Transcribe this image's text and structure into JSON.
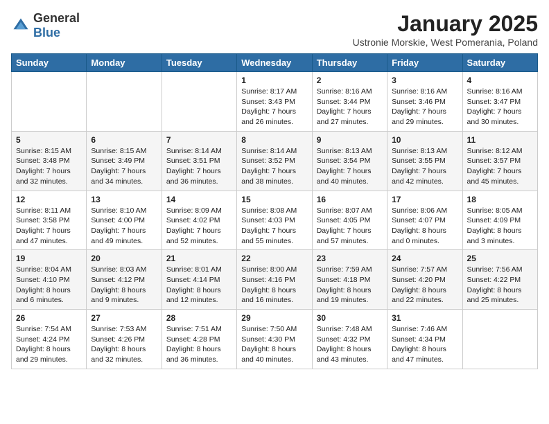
{
  "logo": {
    "general": "General",
    "blue": "Blue"
  },
  "title": "January 2025",
  "subtitle": "Ustronie Morskie, West Pomerania, Poland",
  "days_header": [
    "Sunday",
    "Monday",
    "Tuesday",
    "Wednesday",
    "Thursday",
    "Friday",
    "Saturday"
  ],
  "weeks": [
    [
      {
        "day": "",
        "content": ""
      },
      {
        "day": "",
        "content": ""
      },
      {
        "day": "",
        "content": ""
      },
      {
        "day": "1",
        "content": "Sunrise: 8:17 AM\nSunset: 3:43 PM\nDaylight: 7 hours and 26 minutes."
      },
      {
        "day": "2",
        "content": "Sunrise: 8:16 AM\nSunset: 3:44 PM\nDaylight: 7 hours and 27 minutes."
      },
      {
        "day": "3",
        "content": "Sunrise: 8:16 AM\nSunset: 3:46 PM\nDaylight: 7 hours and 29 minutes."
      },
      {
        "day": "4",
        "content": "Sunrise: 8:16 AM\nSunset: 3:47 PM\nDaylight: 7 hours and 30 minutes."
      }
    ],
    [
      {
        "day": "5",
        "content": "Sunrise: 8:15 AM\nSunset: 3:48 PM\nDaylight: 7 hours and 32 minutes."
      },
      {
        "day": "6",
        "content": "Sunrise: 8:15 AM\nSunset: 3:49 PM\nDaylight: 7 hours and 34 minutes."
      },
      {
        "day": "7",
        "content": "Sunrise: 8:14 AM\nSunset: 3:51 PM\nDaylight: 7 hours and 36 minutes."
      },
      {
        "day": "8",
        "content": "Sunrise: 8:14 AM\nSunset: 3:52 PM\nDaylight: 7 hours and 38 minutes."
      },
      {
        "day": "9",
        "content": "Sunrise: 8:13 AM\nSunset: 3:54 PM\nDaylight: 7 hours and 40 minutes."
      },
      {
        "day": "10",
        "content": "Sunrise: 8:13 AM\nSunset: 3:55 PM\nDaylight: 7 hours and 42 minutes."
      },
      {
        "day": "11",
        "content": "Sunrise: 8:12 AM\nSunset: 3:57 PM\nDaylight: 7 hours and 45 minutes."
      }
    ],
    [
      {
        "day": "12",
        "content": "Sunrise: 8:11 AM\nSunset: 3:58 PM\nDaylight: 7 hours and 47 minutes."
      },
      {
        "day": "13",
        "content": "Sunrise: 8:10 AM\nSunset: 4:00 PM\nDaylight: 7 hours and 49 minutes."
      },
      {
        "day": "14",
        "content": "Sunrise: 8:09 AM\nSunset: 4:02 PM\nDaylight: 7 hours and 52 minutes."
      },
      {
        "day": "15",
        "content": "Sunrise: 8:08 AM\nSunset: 4:03 PM\nDaylight: 7 hours and 55 minutes."
      },
      {
        "day": "16",
        "content": "Sunrise: 8:07 AM\nSunset: 4:05 PM\nDaylight: 7 hours and 57 minutes."
      },
      {
        "day": "17",
        "content": "Sunrise: 8:06 AM\nSunset: 4:07 PM\nDaylight: 8 hours and 0 minutes."
      },
      {
        "day": "18",
        "content": "Sunrise: 8:05 AM\nSunset: 4:09 PM\nDaylight: 8 hours and 3 minutes."
      }
    ],
    [
      {
        "day": "19",
        "content": "Sunrise: 8:04 AM\nSunset: 4:10 PM\nDaylight: 8 hours and 6 minutes."
      },
      {
        "day": "20",
        "content": "Sunrise: 8:03 AM\nSunset: 4:12 PM\nDaylight: 8 hours and 9 minutes."
      },
      {
        "day": "21",
        "content": "Sunrise: 8:01 AM\nSunset: 4:14 PM\nDaylight: 8 hours and 12 minutes."
      },
      {
        "day": "22",
        "content": "Sunrise: 8:00 AM\nSunset: 4:16 PM\nDaylight: 8 hours and 16 minutes."
      },
      {
        "day": "23",
        "content": "Sunrise: 7:59 AM\nSunset: 4:18 PM\nDaylight: 8 hours and 19 minutes."
      },
      {
        "day": "24",
        "content": "Sunrise: 7:57 AM\nSunset: 4:20 PM\nDaylight: 8 hours and 22 minutes."
      },
      {
        "day": "25",
        "content": "Sunrise: 7:56 AM\nSunset: 4:22 PM\nDaylight: 8 hours and 25 minutes."
      }
    ],
    [
      {
        "day": "26",
        "content": "Sunrise: 7:54 AM\nSunset: 4:24 PM\nDaylight: 8 hours and 29 minutes."
      },
      {
        "day": "27",
        "content": "Sunrise: 7:53 AM\nSunset: 4:26 PM\nDaylight: 8 hours and 32 minutes."
      },
      {
        "day": "28",
        "content": "Sunrise: 7:51 AM\nSunset: 4:28 PM\nDaylight: 8 hours and 36 minutes."
      },
      {
        "day": "29",
        "content": "Sunrise: 7:50 AM\nSunset: 4:30 PM\nDaylight: 8 hours and 40 minutes."
      },
      {
        "day": "30",
        "content": "Sunrise: 7:48 AM\nSunset: 4:32 PM\nDaylight: 8 hours and 43 minutes."
      },
      {
        "day": "31",
        "content": "Sunrise: 7:46 AM\nSunset: 4:34 PM\nDaylight: 8 hours and 47 minutes."
      },
      {
        "day": "",
        "content": ""
      }
    ]
  ]
}
